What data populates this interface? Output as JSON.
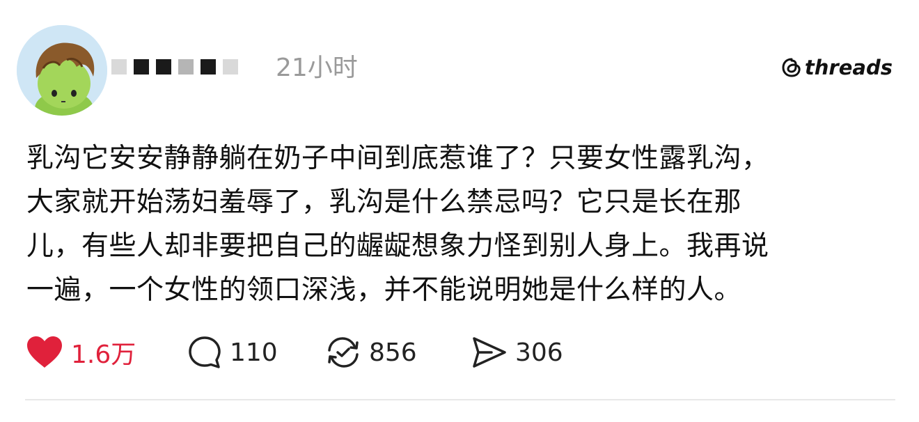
{
  "header": {
    "timestamp": "21小时",
    "brand": "threads"
  },
  "post": {
    "lines": [
      "乳沟它安安静静躺在奶子中间到底惹谁了？只要女性露乳沟，",
      "大家就开始荡妇羞辱了，乳沟是什么禁忌吗？它只是长在那",
      "儿，有些人却非要把自己的龌龊想象力怪到别人身上。我再说",
      "一遍，一个女性的领口深浅，并不能说明她是什么样的人。"
    ]
  },
  "actions": {
    "likes": "1.6万",
    "comments": "110",
    "reposts": "856",
    "shares": "306"
  },
  "colors": {
    "like": "#e0213b",
    "timestamp": "#9a9a9a",
    "text": "#111111"
  },
  "icons": {
    "like": "heart-icon",
    "comment": "comment-bubble-icon",
    "repost": "repost-icon",
    "share": "send-icon",
    "brand": "threads-logo-icon"
  }
}
